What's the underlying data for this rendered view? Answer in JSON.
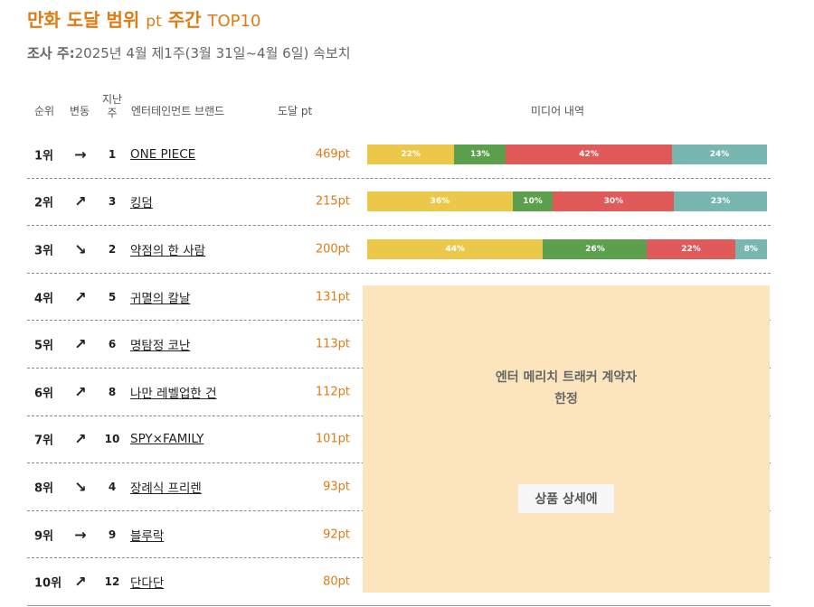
{
  "header": {
    "title_main": "만화 도달 범위",
    "title_pt": "pt",
    "title_period": "주간",
    "title_top": "TOP10",
    "survey_label": "조사 주:",
    "survey_date": "2025년 4월 제1주(3월 31일~4월 6일) 속보치"
  },
  "columns": {
    "rank": "순위",
    "change": "변동",
    "last_week_line1": "지난",
    "last_week_line2": "주",
    "brand": "엔터테인먼트 브랜드",
    "points": "도달 pt",
    "media": "미디어 내역"
  },
  "colors": {
    "accent": "#e07b14",
    "seg_yellow": "#ecc84a",
    "seg_green": "#5c9f4c",
    "seg_red": "#e05a5a",
    "seg_teal": "#78b7b0",
    "locked_bg": "#fce5bd"
  },
  "rows": [
    {
      "rank": "1위",
      "change": "→",
      "last": "1",
      "brand": "ONE PIECE",
      "points": "469pt",
      "media": [
        {
          "label": "22%",
          "value": 22,
          "color": "#ecc84a"
        },
        {
          "label": "13%",
          "value": 13,
          "color": "#5c9f4c"
        },
        {
          "label": "42%",
          "value": 42,
          "color": "#e05a5a"
        },
        {
          "label": "24%",
          "value": 24,
          "color": "#78b7b0"
        }
      ]
    },
    {
      "rank": "2위",
      "change": "↗",
      "last": "3",
      "brand": "킹덤",
      "points": "215pt",
      "media": [
        {
          "label": "36%",
          "value": 36,
          "color": "#ecc84a"
        },
        {
          "label": "10%",
          "value": 10,
          "color": "#5c9f4c"
        },
        {
          "label": "30%",
          "value": 30,
          "color": "#e05a5a"
        },
        {
          "label": "23%",
          "value": 23,
          "color": "#78b7b0"
        }
      ]
    },
    {
      "rank": "3위",
      "change": "↘",
      "last": "2",
      "brand": "약점의 한 사람",
      "points": "200pt",
      "media": [
        {
          "label": "44%",
          "value": 44,
          "color": "#ecc84a"
        },
        {
          "label": "26%",
          "value": 26,
          "color": "#5c9f4c"
        },
        {
          "label": "22%",
          "value": 22,
          "color": "#e05a5a"
        },
        {
          "label": "8%",
          "value": 8,
          "color": "#78b7b0"
        }
      ]
    },
    {
      "rank": "4위",
      "change": "↗",
      "last": "5",
      "brand": "귀멸의 칼날",
      "points": "131pt"
    },
    {
      "rank": "5위",
      "change": "↗",
      "last": "6",
      "brand": "명탐정 코난",
      "points": "113pt"
    },
    {
      "rank": "6위",
      "change": "↗",
      "last": "8",
      "brand": "나만 레벨업한 건",
      "points": "112pt"
    },
    {
      "rank": "7위",
      "change": "↗",
      "last": "10",
      "brand": "SPY×FAMILY",
      "points": "101pt"
    },
    {
      "rank": "8위",
      "change": "↘",
      "last": "4",
      "brand": "장례식 프리렌",
      "points": "93pt"
    },
    {
      "rank": "9위",
      "change": "→",
      "last": "9",
      "brand": "블루락",
      "points": "92pt"
    },
    {
      "rank": "10위",
      "change": "↗",
      "last": "12",
      "brand": "단다단",
      "points": "80pt"
    }
  ],
  "locked": {
    "line1": "엔터 메리치 트래커 계약자",
    "line2": "한정",
    "button_label": "상품 상세에"
  }
}
